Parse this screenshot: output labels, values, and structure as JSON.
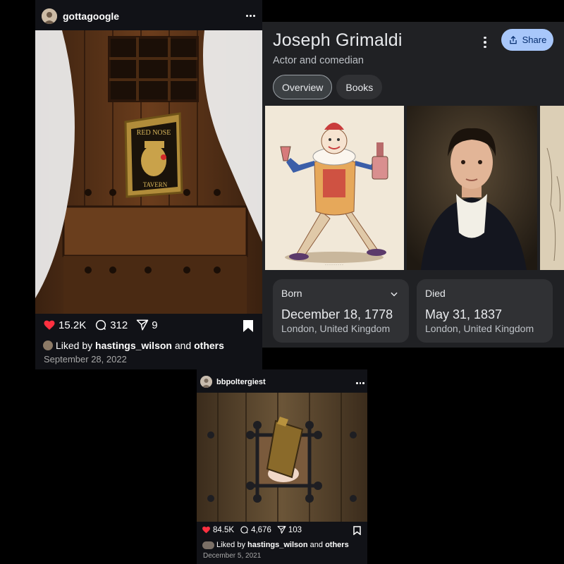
{
  "knowledge_panel": {
    "title": "Joseph Grimaldi",
    "subtitle": "Actor and comedian",
    "share_label": "Share",
    "more_icon": "more-vert-icon",
    "tabs": [
      {
        "label": "Overview",
        "active": true
      },
      {
        "label": "Books",
        "active": false
      }
    ],
    "cards": {
      "born": {
        "label": "Born",
        "date": "December 18, 1778",
        "place": "London, United Kingdom"
      },
      "died": {
        "label": "Died",
        "date": "May 31, 1837",
        "place": "London, United Kingdom"
      }
    },
    "colors": {
      "panel_bg": "#202124",
      "card_bg": "#303134",
      "share_bg": "#a8c7fa"
    }
  },
  "post1": {
    "username": "gottagoogle",
    "likes": "15.2K",
    "comments": "312",
    "shares": "9",
    "liked_by_prefix": "Liked by ",
    "liked_by_user": "hastings_wilson",
    "liked_by_and": " and ",
    "liked_by_others": "others",
    "date": "September 28, 2022"
  },
  "post2": {
    "username": "bbpoltergiest",
    "likes": "84.5K",
    "comments": "4,676",
    "shares": "103",
    "liked_by_prefix": "Liked by ",
    "liked_by_user": "hastings_wilson",
    "liked_by_and": " and ",
    "liked_by_others": "others",
    "date": "December 5, 2021"
  },
  "colors": {
    "heart_red": "#ff3040",
    "background": "#000000"
  }
}
